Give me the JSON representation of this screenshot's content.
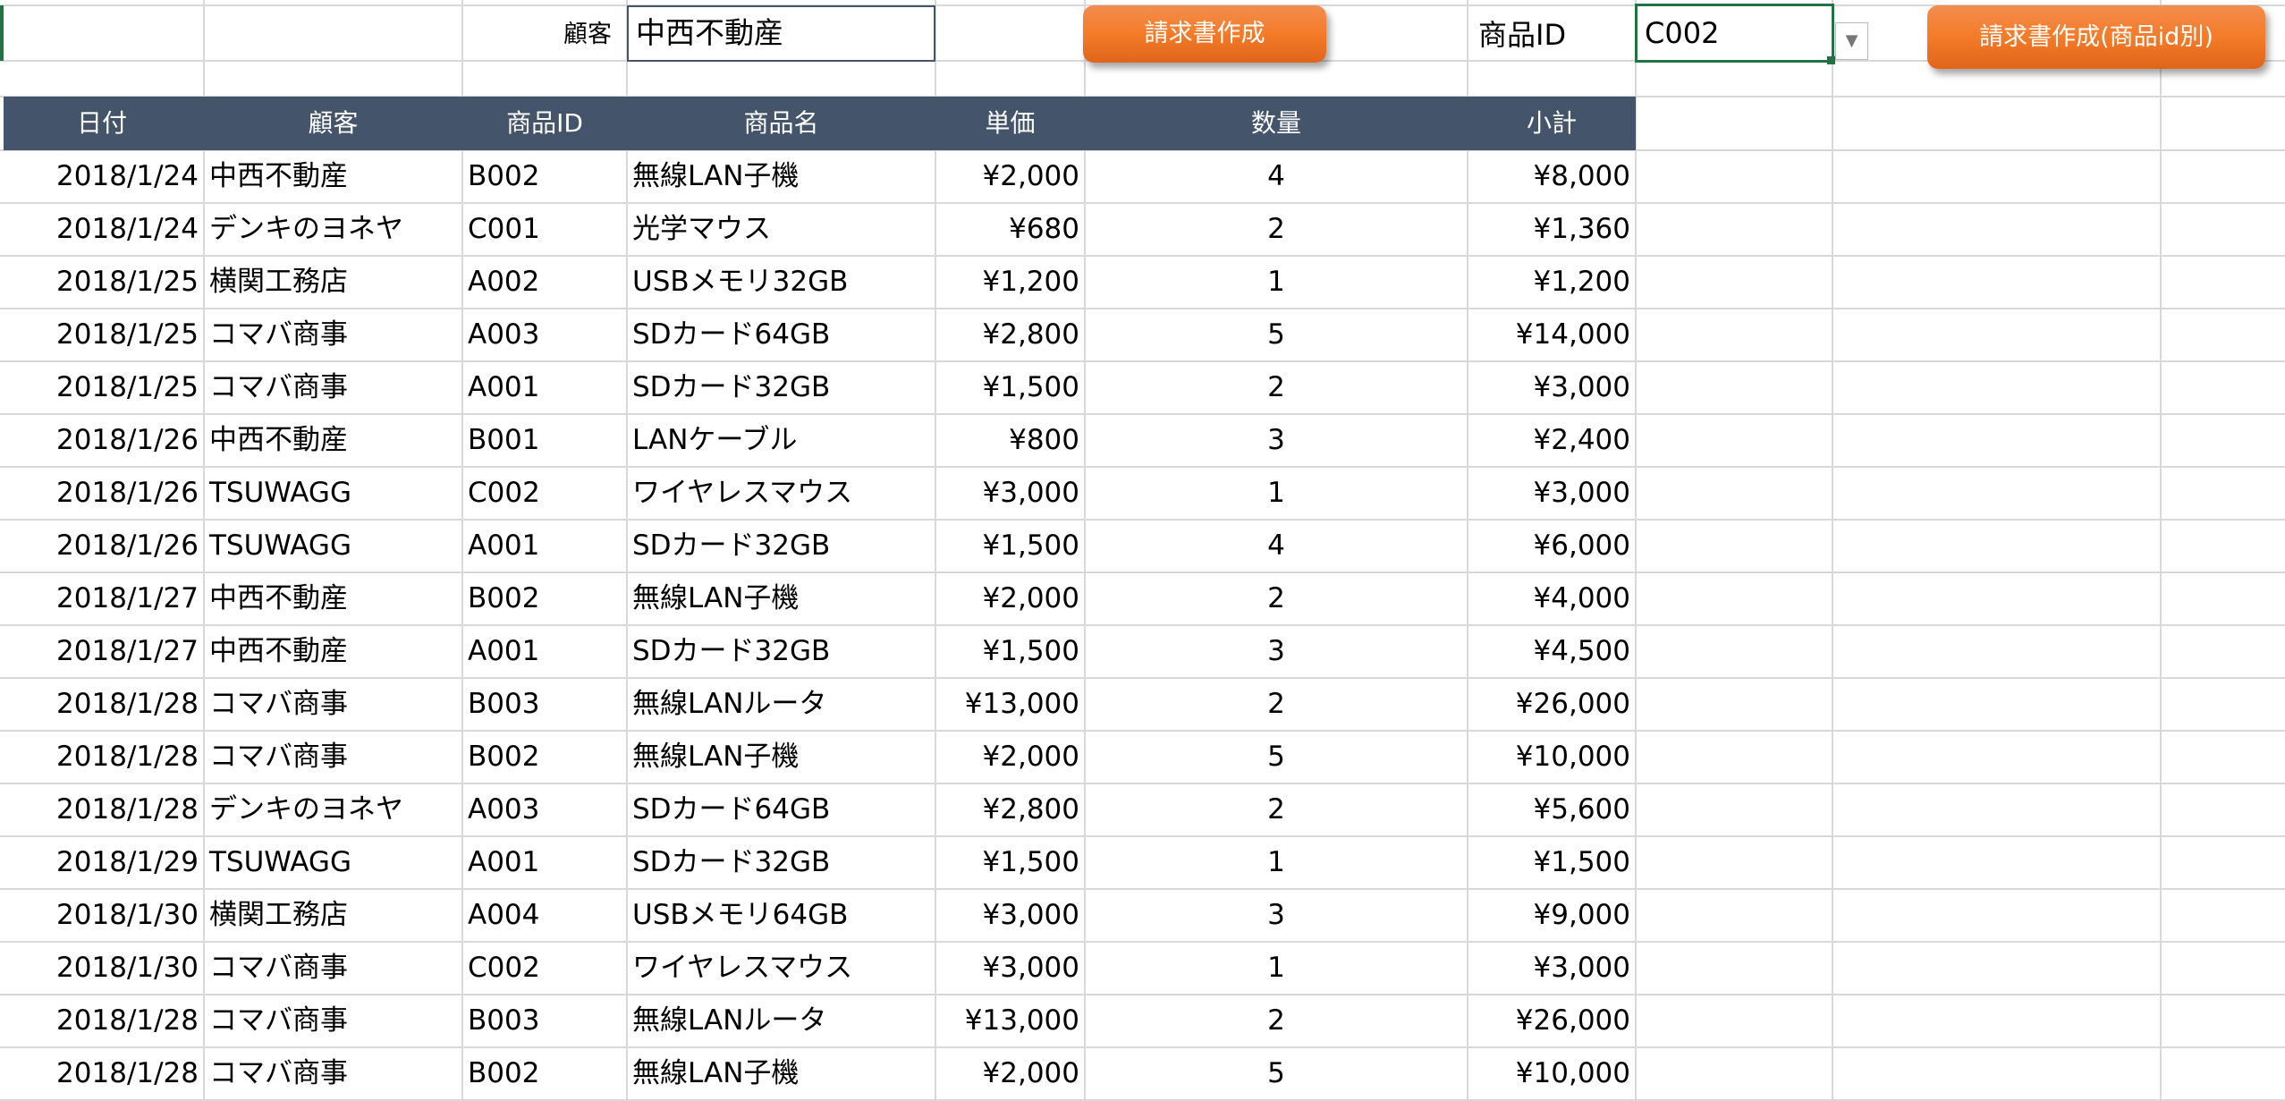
{
  "search": {
    "customer_label": "顧客",
    "customer_value": "中西不動産",
    "product_label": "商品ID",
    "product_value": "C002"
  },
  "buttons": {
    "invoice": "請求書作成",
    "invoice_by_product": "請求書作成(商品id別)"
  },
  "colors": {
    "header": "#44546a",
    "button": "#f47b28",
    "selection": "#217346"
  },
  "table": {
    "headers": [
      "日付",
      "顧客",
      "商品ID",
      "商品名",
      "単価",
      "数量",
      "小計"
    ],
    "rows": [
      [
        "2018/1/24",
        "中西不動産",
        "B002",
        "無線LAN子機",
        "¥2,000",
        "4",
        "¥8,000"
      ],
      [
        "2018/1/24",
        "デンキのヨネヤ",
        "C001",
        "光学マウス",
        "¥680",
        "2",
        "¥1,360"
      ],
      [
        "2018/1/25",
        "横関工務店",
        "A002",
        "USBメモリ32GB",
        "¥1,200",
        "1",
        "¥1,200"
      ],
      [
        "2018/1/25",
        "コマバ商事",
        "A003",
        "SDカード64GB",
        "¥2,800",
        "5",
        "¥14,000"
      ],
      [
        "2018/1/25",
        "コマバ商事",
        "A001",
        "SDカード32GB",
        "¥1,500",
        "2",
        "¥3,000"
      ],
      [
        "2018/1/26",
        "中西不動産",
        "B001",
        "LANケーブル",
        "¥800",
        "3",
        "¥2,400"
      ],
      [
        "2018/1/26",
        "TSUWAGG",
        "C002",
        "ワイヤレスマウス",
        "¥3,000",
        "1",
        "¥3,000"
      ],
      [
        "2018/1/26",
        "TSUWAGG",
        "A001",
        "SDカード32GB",
        "¥1,500",
        "4",
        "¥6,000"
      ],
      [
        "2018/1/27",
        "中西不動産",
        "B002",
        "無線LAN子機",
        "¥2,000",
        "2",
        "¥4,000"
      ],
      [
        "2018/1/27",
        "中西不動産",
        "A001",
        "SDカード32GB",
        "¥1,500",
        "3",
        "¥4,500"
      ],
      [
        "2018/1/28",
        "コマバ商事",
        "B003",
        "無線LANルータ",
        "¥13,000",
        "2",
        "¥26,000"
      ],
      [
        "2018/1/28",
        "コマバ商事",
        "B002",
        "無線LAN子機",
        "¥2,000",
        "5",
        "¥10,000"
      ],
      [
        "2018/1/28",
        "デンキのヨネヤ",
        "A003",
        "SDカード64GB",
        "¥2,800",
        "2",
        "¥5,600"
      ],
      [
        "2018/1/29",
        "TSUWAGG",
        "A001",
        "SDカード32GB",
        "¥1,500",
        "1",
        "¥1,500"
      ],
      [
        "2018/1/30",
        "横関工務店",
        "A004",
        "USBメモリ64GB",
        "¥3,000",
        "3",
        "¥9,000"
      ],
      [
        "2018/1/30",
        "コマバ商事",
        "C002",
        "ワイヤレスマウス",
        "¥3,000",
        "1",
        "¥3,000"
      ],
      [
        "2018/1/28",
        "コマバ商事",
        "B003",
        "無線LANルータ",
        "¥13,000",
        "2",
        "¥26,000"
      ],
      [
        "2018/1/28",
        "コマバ商事",
        "B002",
        "無線LAN子機",
        "¥2,000",
        "5",
        "¥10,000"
      ]
    ]
  }
}
